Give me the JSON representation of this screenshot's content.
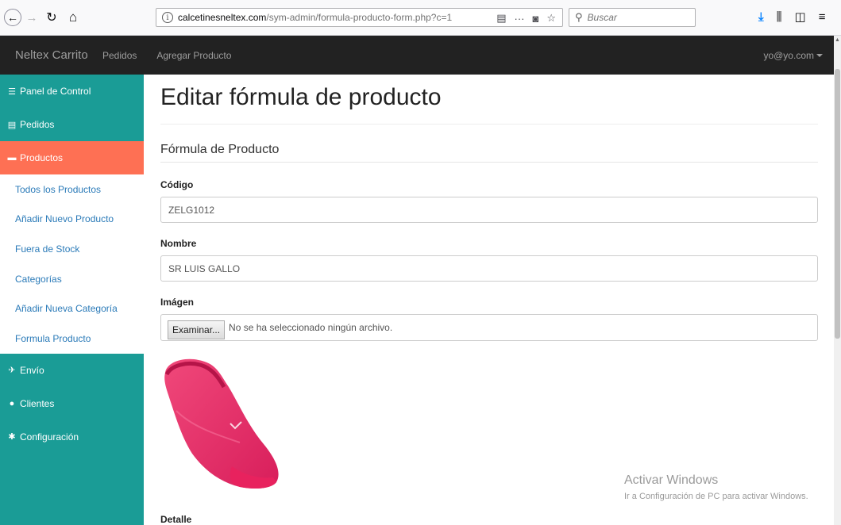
{
  "browser": {
    "url_domain": "calcetinesneltex.com",
    "url_path": "/sym-admin/formula-producto-form.php?c=1",
    "search_placeholder": "Buscar"
  },
  "navbar": {
    "brand": "Neltex Carrito",
    "links": [
      "Pedidos",
      "Agregar Producto"
    ],
    "user": "yo@yo.com"
  },
  "sidebar": {
    "items": [
      {
        "label": "Panel de Control",
        "icon": "dashboard-icon"
      },
      {
        "label": "Pedidos",
        "icon": "list-icon"
      },
      {
        "label": "Productos",
        "icon": "briefcase-icon",
        "active": true
      }
    ],
    "subitems": [
      "Todos los Productos",
      "Añadir Nuevo Producto",
      "Fuera de Stock",
      "Categorías",
      "Añadir Nueva Categoría",
      "Formula Producto"
    ],
    "items_after": [
      {
        "label": "Envío",
        "icon": "plane-icon"
      },
      {
        "label": "Clientes",
        "icon": "user-icon"
      },
      {
        "label": "Configuración",
        "icon": "cog-icon"
      }
    ],
    "colors": {
      "background": "#1a9c96",
      "active": "#fe7054"
    }
  },
  "main": {
    "title": "Editar fórmula de producto",
    "section": "Fórmula de Producto",
    "fields": {
      "codigo_label": "Código",
      "codigo_value": "ZELG1012",
      "nombre_label": "Nombre",
      "nombre_value": "SR LUIS GALLO",
      "imagen_label": "Imágen",
      "file_button": "Examinar...",
      "file_status": "No se ha seleccionado ningún archivo.",
      "detalle_label": "Detalle"
    }
  },
  "watermark": {
    "line1": "Activar Windows",
    "line2": "Ir a Configuración de PC para activar Windows."
  }
}
